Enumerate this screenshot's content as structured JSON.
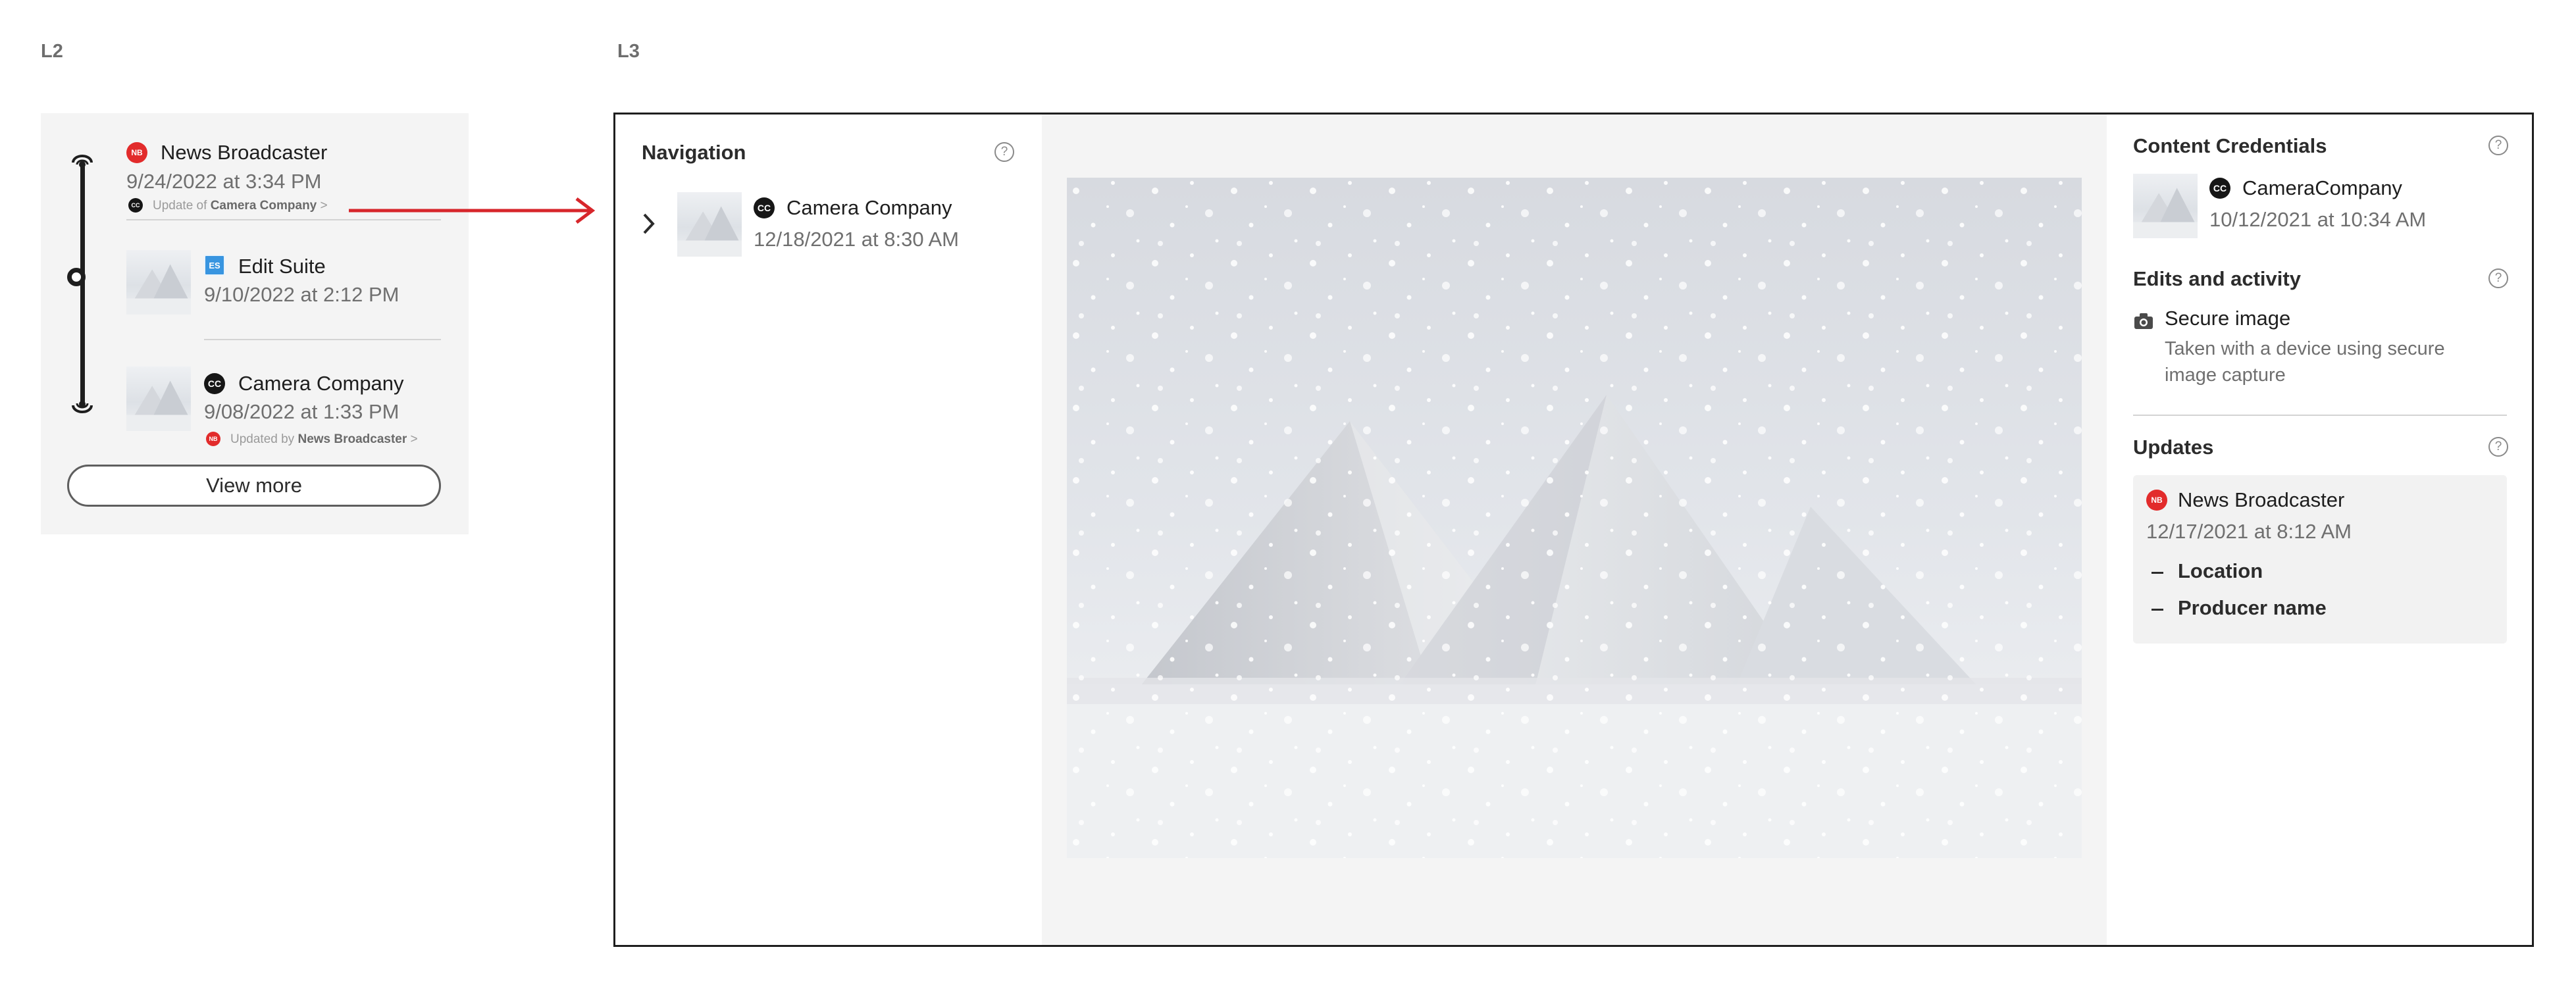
{
  "labels": {
    "l2": "L2",
    "l3": "L3"
  },
  "colors": {
    "accent_red": "#d7262b",
    "news_broadcaster": "#e22b2b",
    "edit_suite": "#3895e0",
    "camera_company": "#161616"
  },
  "l2": {
    "items": [
      {
        "badge": "NB",
        "icon": "news-broadcaster-icon",
        "title": "News Broadcaster",
        "date": "9/24/2022 at 3:34 PM",
        "note_prefix": "Update of",
        "note_strong": "Camera Company",
        "note_suffix": ">",
        "note_badge": "CC"
      },
      {
        "badge": "ES",
        "icon": "edit-suite-icon",
        "title": "Edit Suite",
        "date": "9/10/2022 at 2:12 PM"
      },
      {
        "badge": "CC",
        "icon": "camera-company-icon",
        "title": "Camera Company",
        "date": "9/08/2022 at 1:33 PM",
        "note_prefix": "Updated by",
        "note_strong": "News Broadcaster",
        "note_suffix": ">",
        "note_badge": "NB"
      }
    ],
    "view_more": "View more"
  },
  "l3": {
    "navigation": {
      "title": "Navigation",
      "help": "?",
      "item": {
        "badge": "CC",
        "title": "Camera Company",
        "date": "12/18/2021 at 8:30 AM"
      }
    },
    "credentials": {
      "title": "Content Credentials",
      "help": "?",
      "badge": "CC",
      "name": "CameraCompany",
      "date": "10/12/2021 at 10:34 AM"
    },
    "edits": {
      "title": "Edits and activity",
      "help": "?",
      "icon": "camera-icon",
      "item_title": "Secure image",
      "item_desc_1": "Taken with a device using secure",
      "item_desc_2": "image capture"
    },
    "updates": {
      "title": "Updates",
      "help": "?",
      "badge": "NB",
      "name": "News Broadcaster",
      "date": "12/17/2021 at 8:12 AM",
      "items": [
        "Location",
        "Producer name"
      ]
    }
  }
}
